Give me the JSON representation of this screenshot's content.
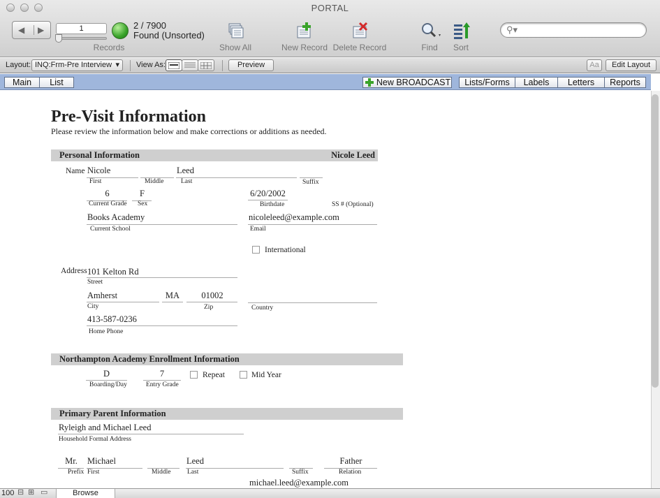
{
  "window": {
    "title": "PORTAL"
  },
  "toolbar": {
    "record_number": "1",
    "records_label": "Records",
    "found_count": "2 / 7900",
    "found_state": "Found (Unsorted)",
    "show_all": "Show All",
    "new_record": "New Record",
    "delete_record": "Delete Record",
    "find": "Find",
    "sort": "Sort",
    "search_value": ""
  },
  "layoutbar": {
    "layout_label": "Layout:",
    "layout_value": "INQ:Frm-Pre Interview",
    "view_as_label": "View As:",
    "preview": "Preview",
    "text_size_glyph": "Aa",
    "edit_layout": "Edit Layout"
  },
  "nav": {
    "main": "Main",
    "list": "List",
    "new_broadcast": "New BROADCAST",
    "lists_forms": "Lists/Forms",
    "labels": "Labels",
    "letters": "Letters",
    "reports": "Reports"
  },
  "form": {
    "title": "Pre-Visit Information",
    "subtitle": "Please review the information below and make corrections or additions as needed.",
    "personal": {
      "header": "Personal Information",
      "header_name": "Nicole Leed",
      "name_label": "Name",
      "first": "Nicole",
      "first_cap": "First",
      "middle": "",
      "middle_cap": "Middle",
      "last": "Leed",
      "last_cap": "Last",
      "suffix": "",
      "suffix_cap": "Suffix",
      "grade": "6",
      "grade_cap": "Current Grade",
      "sex": "F",
      "sex_cap": "Sex",
      "birthdate": "6/20/2002",
      "birthdate_cap": "Birthdate",
      "ss_cap": "SS #  (Optional)",
      "school": "Books Academy",
      "school_cap": "Current School",
      "email": "nicoleleed@example.com",
      "email_cap": "Email",
      "international_label": "International",
      "address_label": "Address",
      "street": "101 Kelton Rd",
      "street_cap": "Street",
      "city": "Amherst",
      "city_cap": "City",
      "state": "MA",
      "zip": "01002",
      "zip_cap": "Zip",
      "country": "",
      "country_cap": "Country",
      "phone": "413-587-0236",
      "phone_cap": "Home Phone"
    },
    "enrollment": {
      "header": "Northampton Academy Enrollment Information",
      "boarding": "D",
      "boarding_cap": "Boarding/Day",
      "entry_grade": "7",
      "entry_grade_cap": "Entry Grade",
      "repeat_label": "Repeat",
      "midyear_label": "Mid Year"
    },
    "parent": {
      "header": "Primary Parent Information",
      "household": "Ryleigh and Michael Leed",
      "household_cap": "Household Formal Address",
      "prefix": "Mr.",
      "prefix_cap": "Prefix",
      "first": "Michael",
      "first_cap": "First",
      "middle_cap": "Middle",
      "last": "Leed",
      "last_cap": "Last",
      "suffix_cap": "Suffix",
      "relation": "Father",
      "relation_cap": "Relation",
      "email": "michael.leed@example.com"
    }
  },
  "status": {
    "zoom": "100",
    "mode": "Browse"
  }
}
